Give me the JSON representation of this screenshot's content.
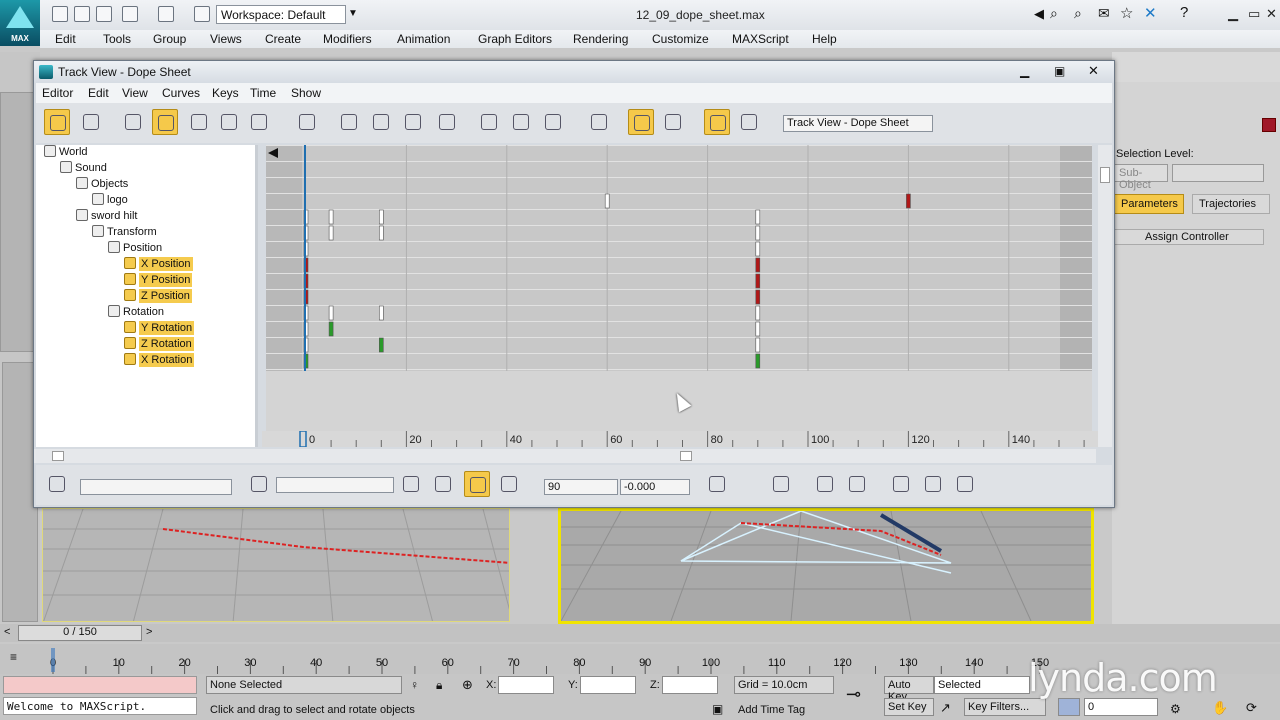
{
  "app": {
    "logo_label": "MAX",
    "workspace_label": "Workspace: Default",
    "filename": "12_09_dope_sheet.max"
  },
  "menubar": [
    "Edit",
    "Tools",
    "Group",
    "Views",
    "Create",
    "Modifiers",
    "Animation",
    "Graph Editors",
    "Rendering",
    "Customize",
    "MAXScript",
    "Help"
  ],
  "trackview": {
    "title": "Track View - Dope Sheet",
    "menu": [
      "Editor",
      "Edit",
      "View",
      "Curves",
      "Keys",
      "Time",
      "Show"
    ],
    "name_field": "Track View - Dope Sheet",
    "tree": [
      {
        "label": "World",
        "indent": 0,
        "icon": "world-icon",
        "highlight": false
      },
      {
        "label": "Sound",
        "indent": 1,
        "icon": "sound-icon",
        "highlight": false
      },
      {
        "label": "Objects",
        "indent": 2,
        "icon": "objects-icon",
        "highlight": false
      },
      {
        "label": "logo",
        "indent": 3,
        "icon": "object-icon",
        "highlight": false
      },
      {
        "label": "sword hilt",
        "indent": 2,
        "icon": "object-icon",
        "highlight": false
      },
      {
        "label": "Transform",
        "indent": 3,
        "icon": "transform-icon",
        "highlight": false
      },
      {
        "label": "Position",
        "indent": 4,
        "icon": "controller-icon",
        "highlight": false
      },
      {
        "label": "X Position",
        "indent": 5,
        "icon": "curve-icon",
        "highlight": true
      },
      {
        "label": "Y Position",
        "indent": 5,
        "icon": "curve-icon",
        "highlight": true
      },
      {
        "label": "Z Position",
        "indent": 5,
        "icon": "curve-icon",
        "highlight": true
      },
      {
        "label": "Rotation",
        "indent": 4,
        "icon": "controller-icon",
        "highlight": false
      },
      {
        "label": "Y Rotation",
        "indent": 5,
        "icon": "curve-icon",
        "highlight": true
      },
      {
        "label": "Z Rotation",
        "indent": 5,
        "icon": "curve-icon",
        "highlight": true
      },
      {
        "label": "X Rotation",
        "indent": 5,
        "icon": "curve-icon",
        "highlight": true
      }
    ],
    "ruler_ticks": [
      "0",
      "20",
      "40",
      "60",
      "80",
      "100",
      "120",
      "140"
    ],
    "ruler_values": [
      0,
      20,
      40,
      60,
      80,
      100,
      120,
      140
    ],
    "keys": [
      {
        "row": 3,
        "frame": 60,
        "color": "#ffffff"
      },
      {
        "row": 3,
        "frame": 120,
        "color": "#b01818"
      },
      {
        "row": 4,
        "frame": 0,
        "color": "#ffffff"
      },
      {
        "row": 4,
        "frame": 5,
        "color": "#ffffff"
      },
      {
        "row": 4,
        "frame": 15,
        "color": "#ffffff"
      },
      {
        "row": 4,
        "frame": 90,
        "color": "#ffffff"
      },
      {
        "row": 5,
        "frame": 0,
        "color": "#ffffff"
      },
      {
        "row": 5,
        "frame": 5,
        "color": "#ffffff"
      },
      {
        "row": 5,
        "frame": 15,
        "color": "#ffffff"
      },
      {
        "row": 5,
        "frame": 90,
        "color": "#ffffff"
      },
      {
        "row": 6,
        "frame": 0,
        "color": "#ffffff"
      },
      {
        "row": 6,
        "frame": 90,
        "color": "#ffffff"
      },
      {
        "row": 7,
        "frame": 0,
        "color": "#b01818"
      },
      {
        "row": 7,
        "frame": 90,
        "color": "#b01818"
      },
      {
        "row": 8,
        "frame": 0,
        "color": "#b01818"
      },
      {
        "row": 8,
        "frame": 90,
        "color": "#b01818"
      },
      {
        "row": 9,
        "frame": 0,
        "color": "#b01818"
      },
      {
        "row": 9,
        "frame": 90,
        "color": "#b01818"
      },
      {
        "row": 10,
        "frame": 0,
        "color": "#ffffff"
      },
      {
        "row": 10,
        "frame": 5,
        "color": "#ffffff"
      },
      {
        "row": 10,
        "frame": 15,
        "color": "#ffffff"
      },
      {
        "row": 10,
        "frame": 90,
        "color": "#ffffff"
      },
      {
        "row": 11,
        "frame": 0,
        "color": "#ffffff"
      },
      {
        "row": 11,
        "frame": 5,
        "color": "#2a9a2a"
      },
      {
        "row": 11,
        "frame": 90,
        "color": "#ffffff"
      },
      {
        "row": 12,
        "frame": 0,
        "color": "#ffffff"
      },
      {
        "row": 12,
        "frame": 15,
        "color": "#2a9a2a"
      },
      {
        "row": 12,
        "frame": 90,
        "color": "#ffffff"
      },
      {
        "row": 13,
        "frame": 0,
        "color": "#2a9a2a"
      },
      {
        "row": 13,
        "frame": 90,
        "color": "#2a9a2a"
      }
    ],
    "bottom": {
      "frame_value": "90",
      "value_field": "-0.000"
    }
  },
  "cmdpanel": {
    "selection_level": "Selection Level:",
    "sub_object": "Sub-Object",
    "tab_parameters": "Parameters",
    "tab_trajectories": "Trajectories",
    "assign_controller": "Assign Controller"
  },
  "timeline": {
    "slider_label": "0 / 150",
    "ticks": [
      "0",
      "10",
      "20",
      "30",
      "40",
      "50",
      "60",
      "70",
      "80",
      "90",
      "100",
      "110",
      "120",
      "130",
      "140",
      "150"
    ],
    "tick_values": [
      0,
      10,
      20,
      30,
      40,
      50,
      60,
      70,
      80,
      90,
      100,
      110,
      120,
      130,
      140,
      150
    ]
  },
  "status": {
    "maxscript_line": "Welcome to MAXScript.",
    "selection": "None Selected",
    "prompt": "Click and drag to select and rotate objects",
    "x_label": "X:",
    "y_label": "Y:",
    "z_label": "Z:",
    "grid": "Grid = 10.0cm",
    "add_time_tag": "Add Time Tag",
    "auto_key": "Auto Key",
    "set_key": "Set Key",
    "selected_option": "Selected",
    "key_filters": "Key Filters...",
    "frame_value": "0"
  },
  "watermark": "lynda.com"
}
